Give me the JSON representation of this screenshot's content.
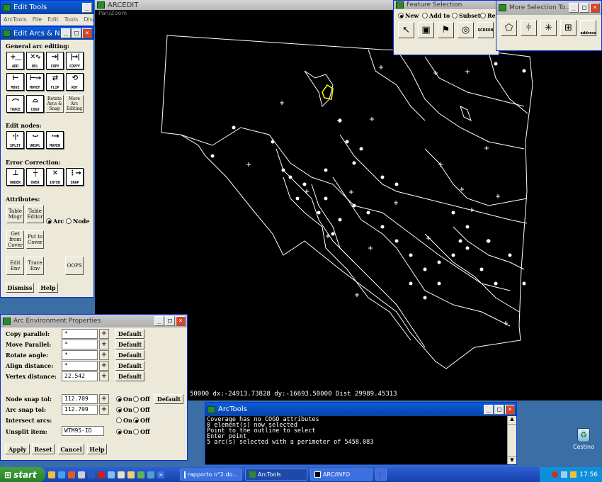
{
  "edit_tools": {
    "title": "Edit Tools",
    "menu": [
      "ArcTools",
      "File",
      "Edit",
      "Tools",
      "Display"
    ]
  },
  "edit_arcs": {
    "title": "Edit Arcs & N...",
    "general_header": "General arc editing:",
    "general_buttons": [
      "ADD",
      "DEL",
      "COPY",
      "COPYF",
      "MOVE",
      "MOVEF",
      "FLIP",
      "ROT",
      "TRACE",
      "COGO",
      "Rotate Arcs & Snap",
      "More Arc Editing"
    ],
    "nodes_header": "Edit nodes:",
    "nodes_buttons": [
      "SPLIT",
      "UNSPL",
      "MOVEN"
    ],
    "error_header": "Error Correction:",
    "error_buttons": [
      "UNDER",
      "OVER",
      "INTER",
      "SNAP"
    ],
    "attr_header": "Attributes:",
    "table_mgr": "Table Mngr",
    "table_editor": "Table Editor",
    "radio_arc": "Arc",
    "radio_node": "Node",
    "get_from_cover": "Get from Cover",
    "put_to_cover": "Put to Cover",
    "edit_env": "Edit Env",
    "trace_env": "Trace Env",
    "oops": "OOPS",
    "dismiss": "Dismiss",
    "help": "Help"
  },
  "arcedit": {
    "title": "ARCEDIT",
    "subtitle": "Pan/Zoom",
    "status": "50000  dx:-24913.73828  dy:-16693.50000  Dist 29989.45313"
  },
  "feature_selection": {
    "title": "Feature Selection",
    "options": [
      "New",
      "Add to",
      "Subset",
      "Rem"
    ],
    "selected": "New",
    "tool_icons": [
      "arrow-icon",
      "box-icon",
      "flag-icon",
      "circle-icon",
      "screen-icon"
    ],
    "screen_label": "SCREEN"
  },
  "more_selection": {
    "title": "More Selection To...",
    "tool_icons": [
      "polygon-select-icon",
      "line-select-icon",
      "star-select-icon",
      "table-select-icon",
      "address-icon"
    ],
    "address_label": "address"
  },
  "arc_env": {
    "title": "Arc Environment Properties",
    "rows": [
      {
        "label": "Copy parallel:",
        "value": "*",
        "default": "Default"
      },
      {
        "label": "Move Parallel:",
        "value": "*",
        "default": "Default"
      },
      {
        "label": "Rotate angle:",
        "value": "*",
        "default": "Default"
      },
      {
        "label": "Align distance:",
        "value": "*",
        "default": "Default"
      },
      {
        "label": "Vertex distance:",
        "value": "22.542",
        "default": "Default"
      }
    ],
    "node_snap": {
      "label": "Node snap tol:",
      "value": "112.709"
    },
    "arc_snap": {
      "label": "Arc snap tol:",
      "value": "112.709"
    },
    "intersect": {
      "label": "Intersect arcs:"
    },
    "unsplit": {
      "label": "Unsplit item:",
      "value": "WTM95-ID"
    },
    "on": "On",
    "off": "Off",
    "default": "Default",
    "buttons": [
      "Apply",
      "Reset",
      "Cancel",
      "Help"
    ]
  },
  "arctools": {
    "title": "ArcTools",
    "lines": [
      "Coverage has no COGO attributes",
      "0 element(s) now selected",
      "Point to the outline to select",
      "Enter point",
      "5 arc(s) selected with a perimeter of 5458.083"
    ]
  },
  "desktop": {
    "recycle_label": "Cestino"
  },
  "taskbar": {
    "start": "start",
    "tasks": [
      "rapporto n°2.do...",
      "ArcTools",
      "ARC/INFO",
      ""
    ],
    "clock": "17.56"
  }
}
